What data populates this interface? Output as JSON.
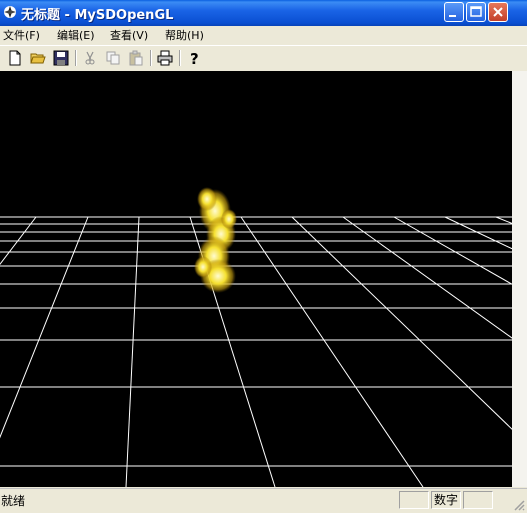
{
  "window": {
    "title": "无标题 - MySDOpenGL",
    "colors": {
      "titlebar": "#1a64e6",
      "viewport_bg": "#000000",
      "grid": "#ffffff",
      "flame": "#f5e030"
    }
  },
  "menu": {
    "items": [
      {
        "label": "文件(F)"
      },
      {
        "label": "编辑(E)"
      },
      {
        "label": "查看(V)"
      },
      {
        "label": "帮助(H)"
      }
    ]
  },
  "toolbar": {
    "buttons": [
      "new-document-icon",
      "open-folder-icon",
      "save-disk-icon",
      "cut-scissors-icon",
      "copy-icon",
      "paste-icon",
      "print-icon",
      "help-question-icon"
    ]
  },
  "status": {
    "text": "就绪",
    "num_indicator": "数字"
  }
}
